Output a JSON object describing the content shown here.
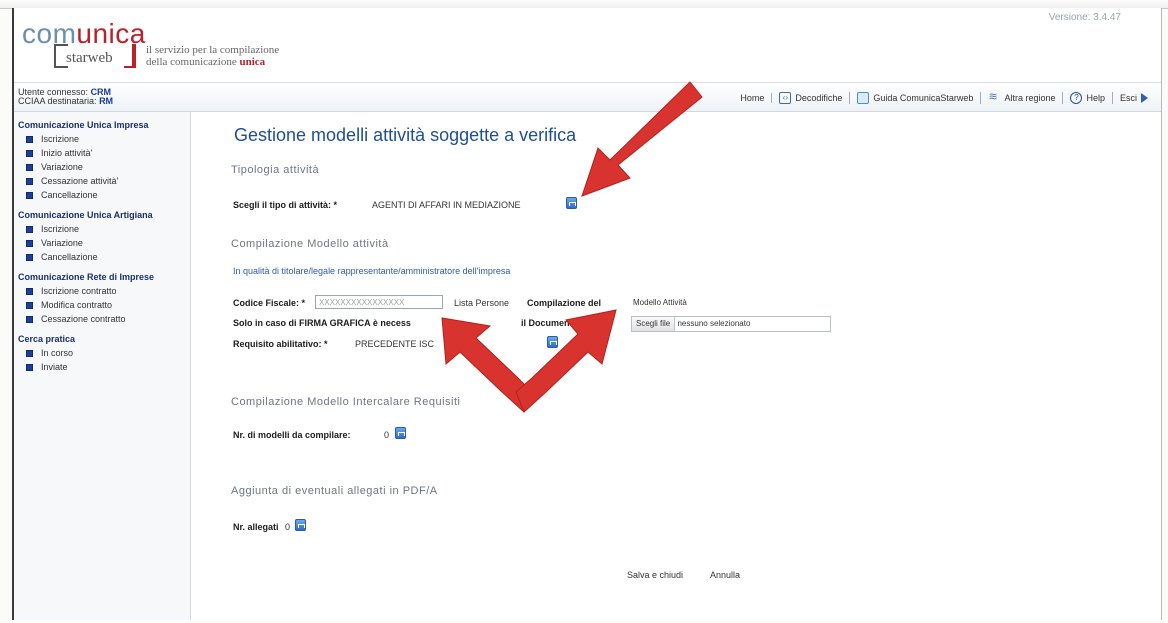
{
  "header": {
    "logo_pre": "com",
    "logo_accent": "unica",
    "logo_sub": "starweb",
    "tagline_line1": "il servizio per la compilazione",
    "tagline_line2_pre": "della comunicazione",
    "tagline_line2_accent": "unica",
    "version": "Versione: 3.4.47"
  },
  "user": {
    "user_label": "Utente connesso:",
    "user_value": "CRM",
    "cciaa_label": "CCIAA destinataria:",
    "cciaa_value": "RM"
  },
  "topnav": [
    {
      "label": "Home",
      "icon": "none"
    },
    {
      "label": "Decodifiche",
      "icon": "code-icon"
    },
    {
      "label": "Guida ComunicaStarweb",
      "icon": "guide-icon"
    },
    {
      "label": "Altra regione",
      "icon": "region-icon"
    },
    {
      "label": "Help",
      "icon": "help-icon"
    },
    {
      "label": "Esci",
      "icon": "exit-icon"
    }
  ],
  "sidebar": {
    "sections": [
      {
        "title": "Comunicazione Unica Impresa",
        "items": [
          "Iscrizione",
          "Inizio attività'",
          "Variazione",
          "Cessazione attività'",
          "Cancellazione"
        ]
      },
      {
        "title": "Comunicazione Unica Artigiana",
        "items": [
          "Iscrizione",
          "Variazione",
          "Cancellazione"
        ]
      },
      {
        "title": "Comunicazione Rete di Imprese",
        "items": [
          "Iscrizione contratto",
          "Modifica contratto",
          "Cessazione contratto"
        ]
      },
      {
        "title": "Cerca pratica",
        "items": [
          "In corso",
          "Inviate"
        ]
      }
    ]
  },
  "main": {
    "page_title": "Gestione modelli attività soggette a verifica",
    "section_tipologia": "Tipologia attività",
    "tipo_label": "Scegli il tipo di attività: *",
    "tipo_value": "AGENTI DI AFFARI IN MEDIAZIONE",
    "section_compilazione": "Compilazione Modello attività",
    "qualita_link": "In qualità di titolare/legale rappresentante/amministratore dell'impresa",
    "cf_label": "Codice Fiscale: *",
    "cf_placeholder": "XXXXXXXXXXXXXXXX",
    "lista_persone": "Lista Persone",
    "compilazione_del_label": "Compilazione del",
    "modello_attivita": "Modello Attività",
    "firma_label_a": "Solo in caso di FIRMA GRAFICA è necess",
    "firma_label_b": "il Documento",
    "file_button": "Scegli file",
    "file_status": "nessuno selezionato",
    "requisito_label": "Requisito abilitativo: *",
    "requisito_value": "PRECEDENTE ISC",
    "section_intercalare": "Compilazione Modello Intercalare Requisiti",
    "nr_modelli_label": "Nr. di modelli da compilare:",
    "nr_modelli_value": "0",
    "section_allegati": "Aggiunta di eventuali allegati in PDF/A",
    "nr_allegati_label": "Nr. allegati",
    "nr_allegati_value": "0",
    "save_close": "Salva e chiudi",
    "cancel": "Annulla"
  },
  "annotation_colors": {
    "arrow": "#d9332f"
  }
}
